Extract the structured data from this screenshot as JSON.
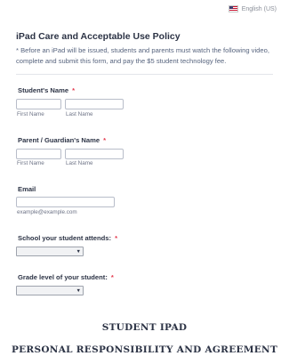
{
  "language": {
    "label": "English (US)",
    "flag_icon": "us-flag-icon"
  },
  "header": {
    "title": "iPad Care and Acceptable Use Policy",
    "subtitle": "* Before an iPad will be issued, students and parents must watch the following video, complete and submit this form, and pay the $5 student technology fee."
  },
  "student_name": {
    "label": "Student's Name",
    "required_mark": "*",
    "first_sublabel": "First Name",
    "last_sublabel": "Last Name",
    "first_value": "",
    "last_value": ""
  },
  "guardian_name": {
    "label": "Parent / Guardian's Name",
    "required_mark": "*",
    "first_sublabel": "First Name",
    "last_sublabel": "Last Name",
    "first_value": "",
    "last_value": ""
  },
  "email": {
    "label": "Email",
    "value": "",
    "sublabel": "example@example.com"
  },
  "school": {
    "label": "School your student attends:",
    "required_mark": "*",
    "selected": "",
    "caret": "▼"
  },
  "grade": {
    "label": "Grade level of your student:",
    "required_mark": "*",
    "selected": "",
    "caret": "▼"
  },
  "section": {
    "heading1": "STUDENT IPAD",
    "heading2": "PERSONAL RESPONSIBILITY AND AGREEMENT"
  },
  "colors": {
    "text": "#2c3345",
    "required": "#e43a4e",
    "input_border": "#b8bdc9",
    "divider": "#e3e5ea"
  }
}
